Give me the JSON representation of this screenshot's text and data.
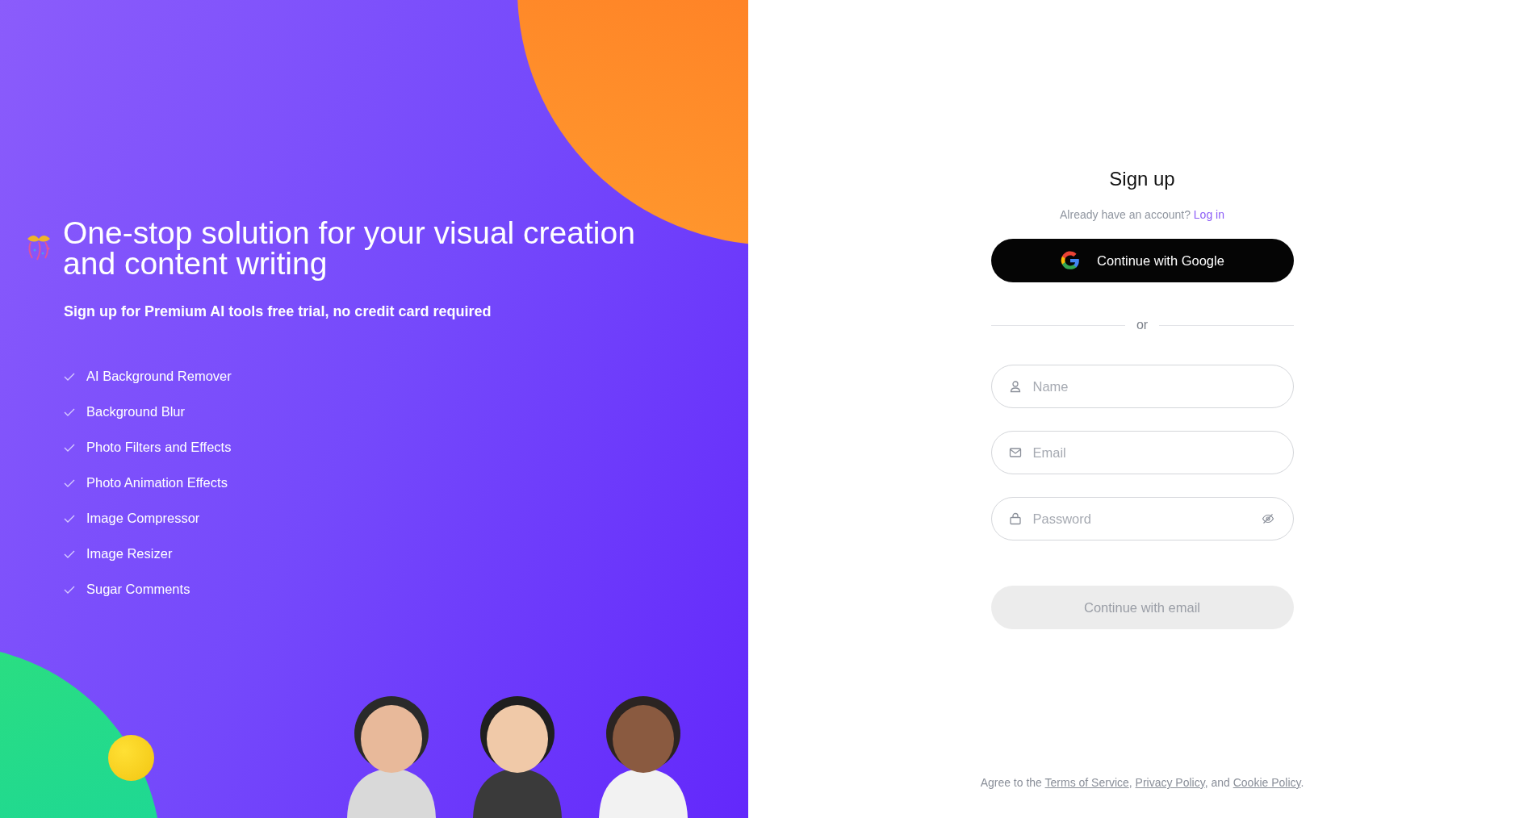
{
  "promo": {
    "headline": "One-stop solution for your visual creation and content writing",
    "subheadline": "Sign up for Premium AI tools free trial, no credit card required",
    "features": [
      "AI Background Remover",
      "Background Blur",
      "Photo Filters and Effects",
      "Photo Animation Effects",
      "Image Compressor",
      "Image Resizer",
      "Sugar Comments"
    ]
  },
  "signup": {
    "title": "Sign up",
    "login_prompt": "Already have an account?",
    "login_link": "Log in",
    "google_button": "Continue with Google",
    "divider": "or",
    "fields": [
      {
        "kind": "name",
        "placeholder": "Name"
      },
      {
        "kind": "email",
        "placeholder": "Email"
      },
      {
        "kind": "password",
        "placeholder": "Password"
      }
    ],
    "submit": {
      "label": "Continue with email",
      "disabled": true
    },
    "footer": [
      {
        "kind": "text",
        "text": "Agree to the "
      },
      {
        "kind": "link",
        "text": "Terms of Service"
      },
      {
        "kind": "text",
        "text": ", "
      },
      {
        "kind": "link",
        "text": "Privacy Policy"
      },
      {
        "kind": "text",
        "text": ", and "
      },
      {
        "kind": "link",
        "text": "Cookie Policy"
      },
      {
        "kind": "text",
        "text": "."
      }
    ]
  }
}
